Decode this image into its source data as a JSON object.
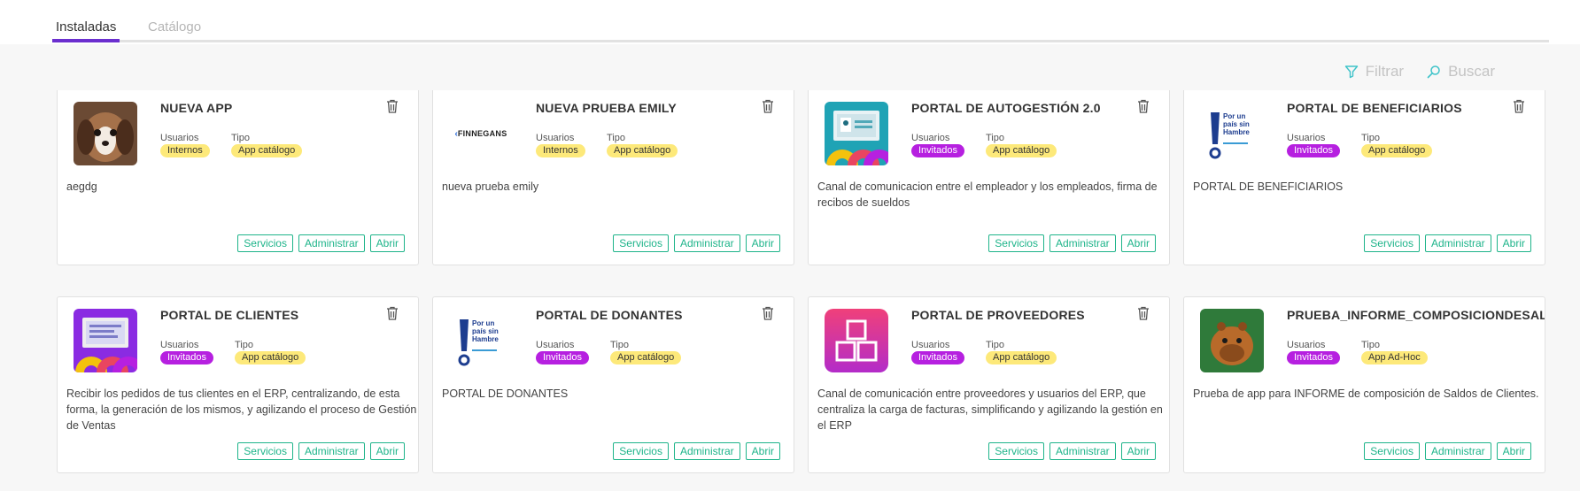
{
  "tabs": [
    {
      "label": "Instaladas",
      "active": true
    },
    {
      "label": "Catálogo",
      "active": false
    }
  ],
  "toolbar": {
    "filter_label": "Filtrar",
    "search_label": "Buscar"
  },
  "labels": {
    "users": "Usuarios",
    "type": "Tipo",
    "services": "Servicios",
    "manage": "Administrar",
    "open": "Abrir"
  },
  "colors": {
    "accent": "#6b2fcf",
    "action": "#1eb48a",
    "badge_yellow": "#fde97a",
    "badge_purple": "#b620e0"
  },
  "apps": [
    {
      "title": "NUEVA APP",
      "users": "Internos",
      "type": "App catálogo",
      "description": "aegdg",
      "logo": "puppy-photo"
    },
    {
      "title": "NUEVA PRUEBA EMILY",
      "users": "Internos",
      "type": "App catálogo",
      "description": "nueva prueba emily",
      "logo": "finnegans-logo",
      "logo_text": "FINNEGANS"
    },
    {
      "title": "PORTAL DE AUTOGESTIÓN 2.0",
      "users": "Invitados",
      "type": "App catálogo",
      "description": "Canal de comunicacion entre el empleador y los empleados, firma de recibos de sueldos",
      "logo": "self-service-icon"
    },
    {
      "title": "PORTAL DE BENEFICIARIOS",
      "users": "Invitados",
      "type": "App catálogo",
      "description": "PORTAL DE BENEFICIARIOS",
      "logo": "hambre-logo",
      "logo_text": "Por un país sin Hambre"
    },
    {
      "title": "PORTAL DE CLIENTES",
      "users": "Invitados",
      "type": "App catálogo",
      "description": "Recibir los pedidos de tus clientes en el ERP, centralizando, de esta forma, la generación de los mismos, y agilizando el proceso de Gestión de Ventas",
      "logo": "clients-icon"
    },
    {
      "title": "PORTAL DE DONANTES",
      "users": "Invitados",
      "type": "App catálogo",
      "description": "PORTAL DE DONANTES",
      "logo": "hambre-logo",
      "logo_text": "Por un país sin Hambre"
    },
    {
      "title": "PORTAL DE PROVEEDORES",
      "users": "Invitados",
      "type": "App catálogo",
      "description": "Canal de comunicación entre proveedores y usuarios del ERP, que centraliza la carga de facturas, simplificando y agilizando la gestión en el ERP",
      "logo": "suppliers-icon"
    },
    {
      "title": "PRUEBA_INFORME_COMPOSICIONDESALDO",
      "users": "Invitados",
      "type": "App Ad-Hoc",
      "description": "Prueba de app para INFORME de composición de Saldos de Clientes.",
      "logo": "capybara-image"
    }
  ]
}
